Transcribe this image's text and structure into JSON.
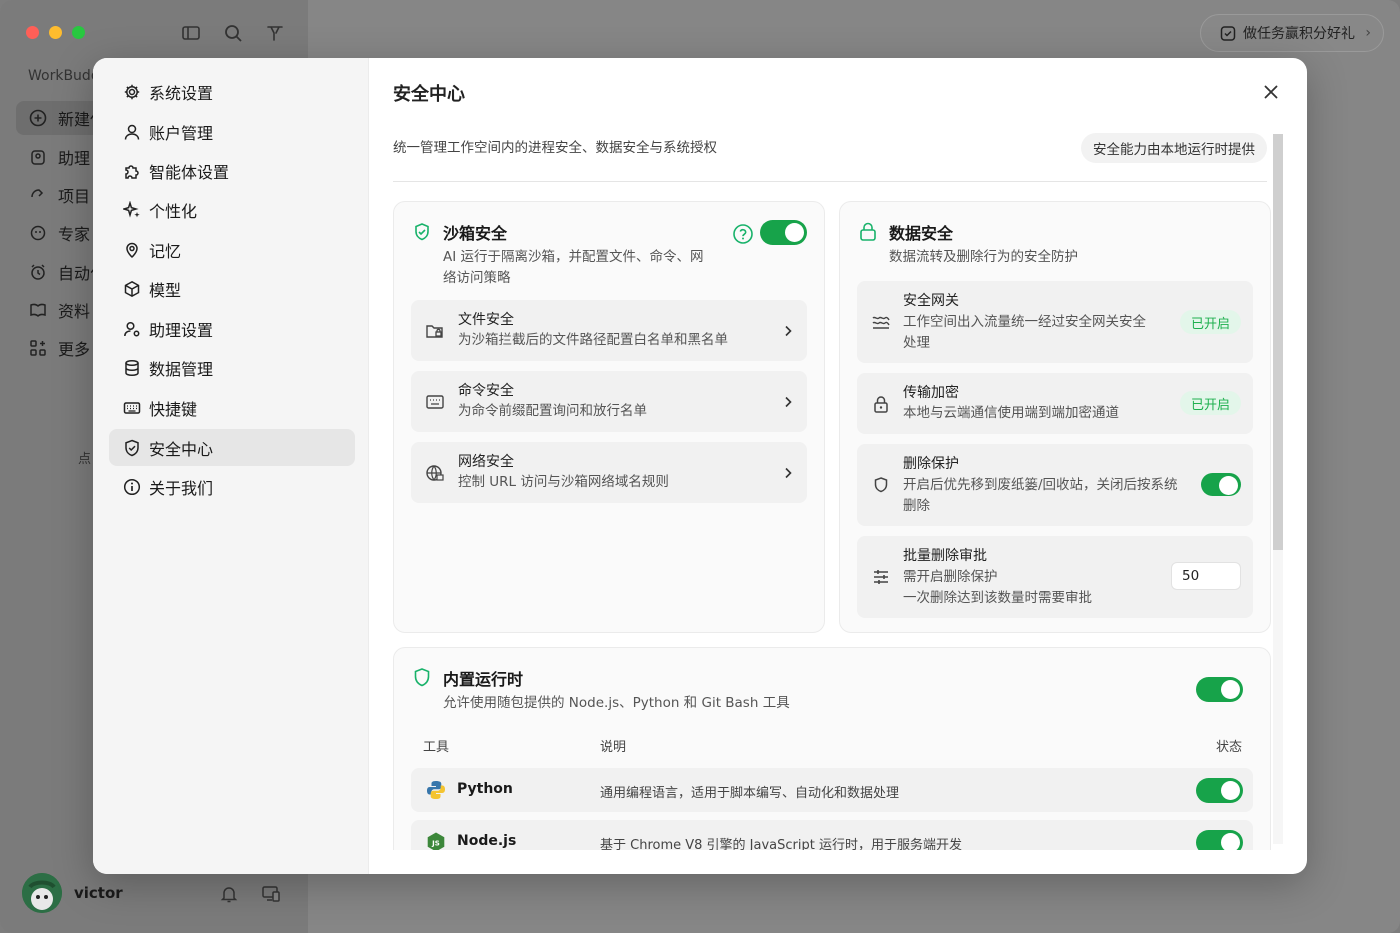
{
  "background": {
    "app_name": "WorkBudd",
    "promo_label": "做任务赢积分好礼",
    "nav": [
      {
        "label": "新建任",
        "icon": "plus-circle-icon"
      },
      {
        "label": "助理",
        "icon": "assistant-icon"
      },
      {
        "label": "项目",
        "icon": "project-icon"
      },
      {
        "label": "专家",
        "icon": "expert-icon"
      },
      {
        "label": "自动化",
        "icon": "alarm-icon"
      },
      {
        "label": "资料",
        "icon": "book-icon"
      },
      {
        "label": "更多",
        "icon": "more-icon"
      }
    ],
    "hint": "点",
    "user_name": "victor"
  },
  "settings": {
    "nav": [
      {
        "label": "系统设置",
        "icon": "gear-icon"
      },
      {
        "label": "账户管理",
        "icon": "user-icon"
      },
      {
        "label": "智能体设置",
        "icon": "puzzle-icon"
      },
      {
        "label": "个性化",
        "icon": "sparkle-icon"
      },
      {
        "label": "记忆",
        "icon": "memory-icon"
      },
      {
        "label": "模型",
        "icon": "cube-icon"
      },
      {
        "label": "助理设置",
        "icon": "user-settings-icon"
      },
      {
        "label": "数据管理",
        "icon": "database-icon"
      },
      {
        "label": "快捷键",
        "icon": "keyboard-icon"
      },
      {
        "label": "安全中心",
        "icon": "shield-icon",
        "active": true
      },
      {
        "label": "关于我们",
        "icon": "info-icon"
      }
    ],
    "title": "安全中心",
    "subtitle": "统一管理工作空间内的进程安全、数据安全与系统授权",
    "local_pill": "安全能力由本地运行时提供",
    "sandbox": {
      "title": "沙箱安全",
      "desc_line1": "AI 运行于隔离沙箱，并配置文件、命令、网",
      "desc_line2": "络访问策略",
      "enabled": true,
      "rows": [
        {
          "title": "文件安全",
          "desc": "为沙箱拦截后的文件路径配置白名单和黑名单",
          "icon": "folder-lock-icon"
        },
        {
          "title": "命令安全",
          "desc": "为命令前缀配置询问和放行名单",
          "icon": "terminal-icon"
        },
        {
          "title": "网络安全",
          "desc": "控制 URL 访问与沙箱网络域名规则",
          "icon": "globe-lock-icon"
        }
      ]
    },
    "data_security": {
      "title": "数据安全",
      "desc": "数据流转及删除行为的安全防护",
      "gateway": {
        "title": "安全网关",
        "desc_line1": "工作空间出入流量统一经过安全网关安全",
        "desc_line2": "处理",
        "badge": "已开启"
      },
      "encryption": {
        "title": "传输加密",
        "desc": "本地与云端通信使用端到端加密通道",
        "badge": "已开启"
      },
      "delete_protect": {
        "title": "删除保护",
        "desc_line1": "开启后优先移到废纸篓/回收站，关闭后按系统",
        "desc_line2": "删除",
        "enabled": true
      },
      "batch_delete": {
        "title": "批量删除审批",
        "desc_line1": "需开启删除保护",
        "desc_line2": "一次删除达到该数量时需要审批",
        "value": "50"
      }
    },
    "runtime": {
      "title": "内置运行时",
      "desc": "允许使用随包提供的 Node.js、Python 和 Git Bash 工具",
      "enabled": true,
      "columns": [
        "工具",
        "说明",
        "状态"
      ],
      "tools": [
        {
          "name": "Python",
          "desc": "通用编程语言，适用于脚本编写、自动化和数据处理",
          "enabled": true,
          "icon": "python-icon"
        },
        {
          "name": "Node.js",
          "desc": "基于 Chrome V8 引擎的 JavaScript 运行时，用于服务端开发",
          "enabled": true,
          "icon": "nodejs-icon"
        }
      ]
    }
  },
  "colors": {
    "accent_green": "#17a34a",
    "badge_bg": "#e3f6ea",
    "badge_text": "#1fb04f"
  }
}
